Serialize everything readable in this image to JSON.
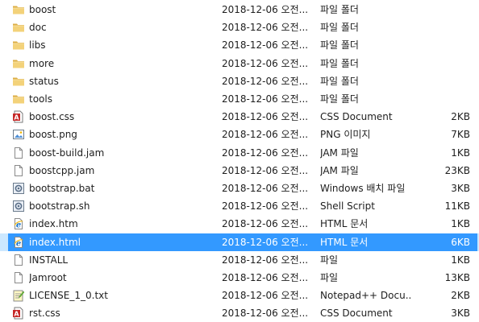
{
  "files": [
    {
      "name": "boost",
      "date": "2018-12-06 오전...",
      "type": "파일 폴더",
      "size": "",
      "icon": "folder-icon"
    },
    {
      "name": "doc",
      "date": "2018-12-06 오전...",
      "type": "파일 폴더",
      "size": "",
      "icon": "folder-icon"
    },
    {
      "name": "libs",
      "date": "2018-12-06 오전...",
      "type": "파일 폴더",
      "size": "",
      "icon": "folder-icon"
    },
    {
      "name": "more",
      "date": "2018-12-06 오전...",
      "type": "파일 폴더",
      "size": "",
      "icon": "folder-icon"
    },
    {
      "name": "status",
      "date": "2018-12-06 오전...",
      "type": "파일 폴더",
      "size": "",
      "icon": "folder-icon"
    },
    {
      "name": "tools",
      "date": "2018-12-06 오전...",
      "type": "파일 폴더",
      "size": "",
      "icon": "folder-icon"
    },
    {
      "name": "boost.css",
      "date": "2018-12-06 오전...",
      "type": "CSS Document",
      "size": "2KB",
      "icon": "css-file-icon"
    },
    {
      "name": "boost.png",
      "date": "2018-12-06 오전...",
      "type": "PNG 이미지",
      "size": "7KB",
      "icon": "image-file-icon"
    },
    {
      "name": "boost-build.jam",
      "date": "2018-12-06 오전...",
      "type": "JAM 파일",
      "size": "1KB",
      "icon": "blank-file-icon"
    },
    {
      "name": "boostcpp.jam",
      "date": "2018-12-06 오전...",
      "type": "JAM 파일",
      "size": "23KB",
      "icon": "blank-file-icon"
    },
    {
      "name": "bootstrap.bat",
      "date": "2018-12-06 오전...",
      "type": "Windows 배치 파일",
      "size": "3KB",
      "icon": "batch-file-icon"
    },
    {
      "name": "bootstrap.sh",
      "date": "2018-12-06 오전...",
      "type": "Shell Script",
      "size": "11KB",
      "icon": "shell-file-icon"
    },
    {
      "name": "index.htm",
      "date": "2018-12-06 오전...",
      "type": "HTML 문서",
      "size": "1KB",
      "icon": "ie-html-icon"
    },
    {
      "name": "index.html",
      "date": "2018-12-06 오전...",
      "type": "HTML 문서",
      "size": "6KB",
      "icon": "ie-html-icon",
      "selected": true
    },
    {
      "name": "INSTALL",
      "date": "2018-12-06 오전...",
      "type": "파일",
      "size": "1KB",
      "icon": "blank-file-icon"
    },
    {
      "name": "Jamroot",
      "date": "2018-12-06 오전...",
      "type": "파일",
      "size": "13KB",
      "icon": "blank-file-icon"
    },
    {
      "name": "LICENSE_1_0.txt",
      "date": "2018-12-06 오전...",
      "type": "Notepad++ Docu...",
      "size": "2KB",
      "icon": "notepadpp-file-icon"
    },
    {
      "name": "rst.css",
      "date": "2018-12-06 오전...",
      "type": "CSS Document",
      "size": "3KB",
      "icon": "css-file-icon"
    }
  ],
  "colors": {
    "selection": "#3399ff",
    "folder": "#e8c15a",
    "text": "#1e1e1e"
  }
}
